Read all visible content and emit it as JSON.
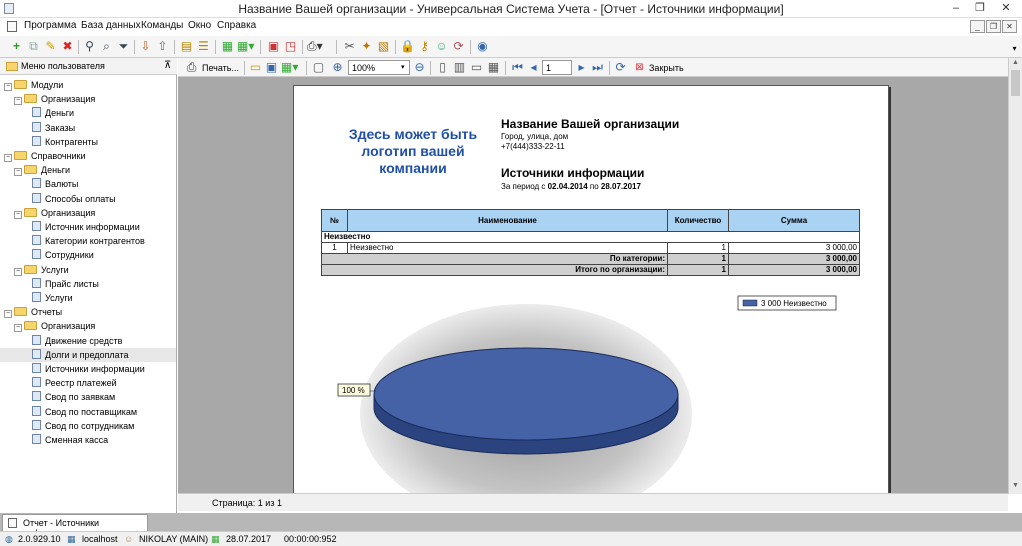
{
  "window": {
    "title": "Название Вашей организации - Универсальная Система Учета - [Отчет - Источники информации]",
    "min": "–",
    "restore": "❐",
    "close": "✕"
  },
  "menu": [
    "Программа",
    "База данных",
    "Команды",
    "Окно",
    "Справка"
  ],
  "sidebar": {
    "header": "Меню пользователя",
    "pin": "⊼",
    "tree": [
      {
        "label": "Модули",
        "level": 0,
        "type": "folder",
        "exp": "−"
      },
      {
        "label": "Организация",
        "level": 1,
        "type": "folder",
        "exp": "−"
      },
      {
        "label": "Деньги",
        "level": 2,
        "type": "doc"
      },
      {
        "label": "Заказы",
        "level": 2,
        "type": "doc"
      },
      {
        "label": "Контрагенты",
        "level": 2,
        "type": "doc"
      },
      {
        "label": "Справочники",
        "level": 0,
        "type": "folder",
        "exp": "−"
      },
      {
        "label": "Деньги",
        "level": 1,
        "type": "folder",
        "exp": "−"
      },
      {
        "label": "Валюты",
        "level": 2,
        "type": "doc"
      },
      {
        "label": "Способы оплаты",
        "level": 2,
        "type": "doc"
      },
      {
        "label": "Организация",
        "level": 1,
        "type": "folder",
        "exp": "−"
      },
      {
        "label": "Источник информации",
        "level": 2,
        "type": "doc"
      },
      {
        "label": "Категории контрагентов",
        "level": 2,
        "type": "doc"
      },
      {
        "label": "Сотрудники",
        "level": 2,
        "type": "doc"
      },
      {
        "label": "Услуги",
        "level": 1,
        "type": "folder",
        "exp": "−"
      },
      {
        "label": "Прайс листы",
        "level": 2,
        "type": "doc"
      },
      {
        "label": "Услуги",
        "level": 2,
        "type": "doc"
      },
      {
        "label": "Отчеты",
        "level": 0,
        "type": "folder",
        "exp": "−"
      },
      {
        "label": "Организация",
        "level": 1,
        "type": "folder",
        "exp": "−"
      },
      {
        "label": "Движение средств",
        "level": 2,
        "type": "doc"
      },
      {
        "label": "Долги и предоплата",
        "level": 2,
        "type": "doc",
        "highlight": true
      },
      {
        "label": "Источники информации",
        "level": 2,
        "type": "doc"
      },
      {
        "label": "Реестр платежей",
        "level": 2,
        "type": "doc"
      },
      {
        "label": "Свод по заявкам",
        "level": 2,
        "type": "doc"
      },
      {
        "label": "Свод по поставщикам",
        "level": 2,
        "type": "doc"
      },
      {
        "label": "Свод по сотрудникам",
        "level": 2,
        "type": "doc"
      },
      {
        "label": "Сменная касса",
        "level": 2,
        "type": "doc"
      }
    ]
  },
  "report_toolbar": {
    "print": "Печать...",
    "zoom": "100%",
    "page": "1",
    "close": "Закрыть"
  },
  "report": {
    "logo": "Здесь может быть логотип вашей компании",
    "org_name": "Название Вашей организации",
    "address": "Город, улица, дом",
    "phone": "+7(444)333-22-11",
    "title": "Источники информации",
    "period_prefix": "За период с",
    "date_from": "02.04.2014",
    "period_mid": "по",
    "date_to": "28.07.2017",
    "table": {
      "headers": [
        "№",
        "Наименование",
        "Количество",
        "Сумма"
      ],
      "group": "Неизвестно",
      "row": {
        "num": "1",
        "name": "Неизвестно",
        "qty": "1",
        "sum": "3 000,00"
      },
      "cat_total": {
        "label": "По категории:",
        "qty": "1",
        "sum": "3 000,00"
      },
      "org_total": {
        "label": "Итого по организации:",
        "qty": "1",
        "sum": "3 000,00"
      }
    },
    "chart_data": {
      "type": "pie",
      "categories": [
        "Неизвестно"
      ],
      "values": [
        3000
      ],
      "legend": [
        "3 000 Неизвестно"
      ],
      "data_labels": [
        "100 %"
      ],
      "legend_position": "top-right",
      "colors": [
        "#4462a5"
      ]
    }
  },
  "page_status": "Страница: 1 из 1",
  "tab": "Отчет - Источники информации",
  "status": {
    "version": "2.0.929.10",
    "host": "localhost",
    "user": "NIKOLAY (MAIN)",
    "date": "28.07.2017",
    "timer": "00:00:00:952"
  }
}
